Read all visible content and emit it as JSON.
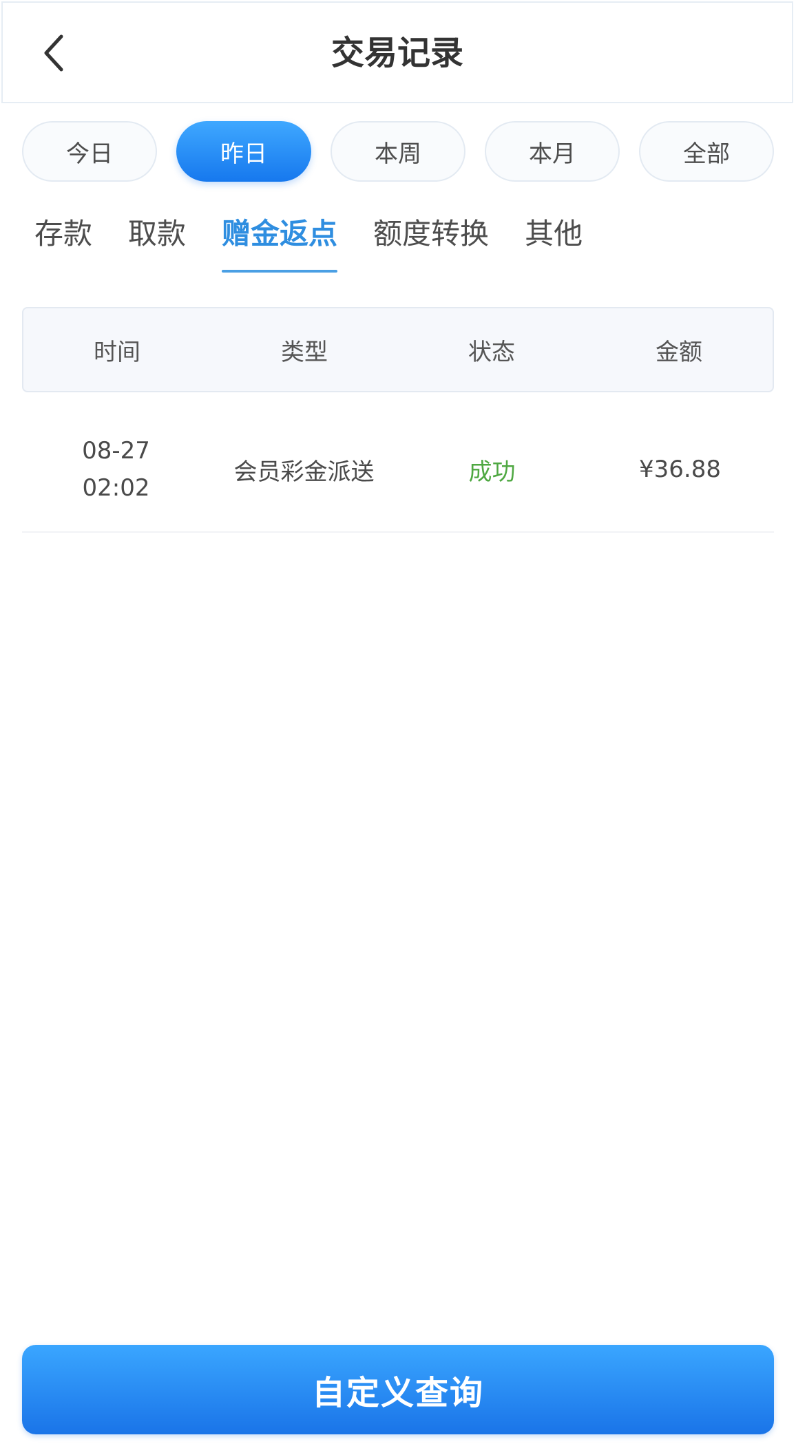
{
  "header": {
    "title": "交易记录",
    "back_icon": "chevron-left-icon"
  },
  "periods": [
    {
      "label": "今日",
      "active": false
    },
    {
      "label": "昨日",
      "active": true
    },
    {
      "label": "本周",
      "active": false
    },
    {
      "label": "本月",
      "active": false
    },
    {
      "label": "全部",
      "active": false
    }
  ],
  "tabs": [
    {
      "label": "存款",
      "active": false
    },
    {
      "label": "取款",
      "active": false
    },
    {
      "label": "赠金返点",
      "active": true
    },
    {
      "label": "额度转换",
      "active": false
    },
    {
      "label": "其他",
      "active": false
    }
  ],
  "table": {
    "columns": [
      "时间",
      "类型",
      "状态",
      "金额"
    ],
    "rows": [
      {
        "date": "08-27",
        "time": "02:02",
        "type": "会员彩金派送",
        "status": "成功",
        "amount": "¥36.88"
      }
    ]
  },
  "footer": {
    "custom_query_label": "自定义查询"
  },
  "colors": {
    "accent": "#1678ee",
    "tab_active": "#2f8ee0",
    "status_success": "#4fa842"
  }
}
